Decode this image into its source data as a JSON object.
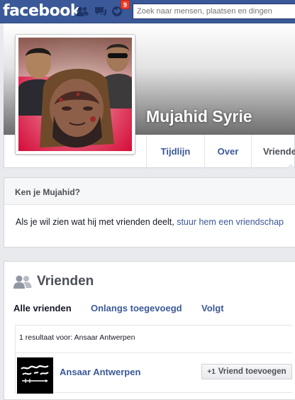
{
  "topbar": {
    "logo": "facebook",
    "notifications_count": "9",
    "search_placeholder": "Zoek naar mensen, plaatsen en dingen",
    "icons": [
      "friend-requests-icon",
      "messages-icon",
      "notifications-icon"
    ]
  },
  "profile": {
    "name": "Mujahid Syrie",
    "tabs": [
      {
        "label": "Tijdlijn"
      },
      {
        "label": "Over"
      },
      {
        "label": "Vrienden"
      }
    ]
  },
  "know_box": {
    "title": "Ken je Mujahid?",
    "text": "Als je wil zien wat hij met vrienden deelt, ",
    "link": "stuur hem een vriendschap"
  },
  "friends": {
    "title": "Vrienden",
    "tabs": [
      {
        "label": "Alle vrienden"
      },
      {
        "label": "Onlangs toegevoegd"
      },
      {
        "label": "Volgt"
      }
    ],
    "results_text": "1 resultaat voor: Ansaar Antwerpen",
    "items": [
      {
        "name": "Ansaar Antwerpen",
        "button_icon": "+1",
        "button_label": "Vriend toevoegen"
      }
    ]
  },
  "colors": {
    "brand": "#3b5998",
    "badge": "#f03d25",
    "background": "#e9eaed"
  }
}
